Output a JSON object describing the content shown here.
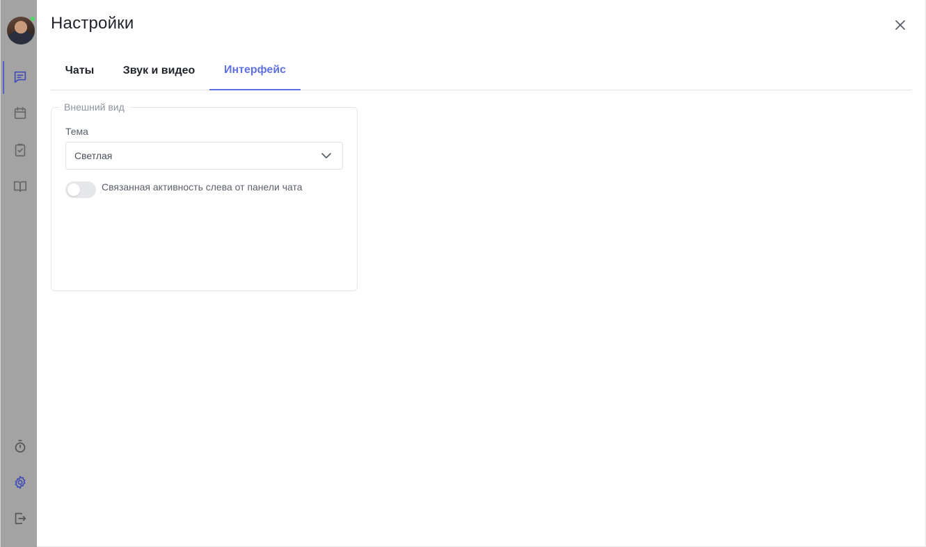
{
  "header": {
    "title": "Настройки"
  },
  "tabs": [
    {
      "label": "Чаты",
      "active": false
    },
    {
      "label": "Звук и видео",
      "active": false
    },
    {
      "label": "Интерфейс",
      "active": true
    }
  ],
  "appearance": {
    "legend": "Внешний вид",
    "theme_label": "Тема",
    "theme_value": "Светлая",
    "toggle_label": "Связанная активность слева от панели чата",
    "toggle_on": false
  },
  "sidebar": {
    "nav_icons": [
      "chat-icon",
      "calendar-icon",
      "tasks-icon",
      "book-icon"
    ],
    "bottom_icons": [
      "timer-icon",
      "settings-icon",
      "logout-icon"
    ]
  },
  "colors": {
    "accent": "#5f6fe4",
    "sidebar_bg": "#a3a3a3",
    "online": "#4cd964"
  }
}
